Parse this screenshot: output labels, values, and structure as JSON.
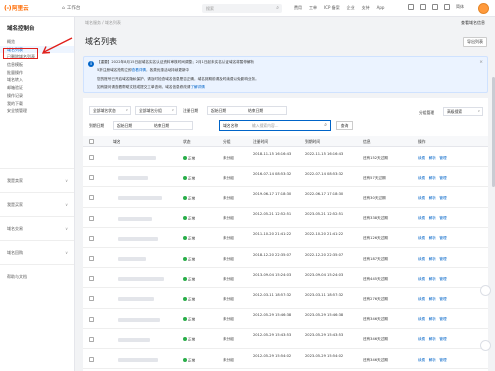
{
  "topbar": {
    "logo_mark": "(-)",
    "logo_text": "阿里云",
    "workbench": "工作台",
    "search_placeholder": "搜索",
    "nav": [
      "费用",
      "工单",
      "ICP 备案",
      "企业",
      "支持",
      "App"
    ],
    "lang": "简体"
  },
  "sidebar": {
    "title": "域名控制台",
    "items": [
      "概览",
      "域名列表",
      "已删除域名列表",
      "信息模板",
      "批量操作",
      "域名转入",
      "邮箱验证",
      "操作记录",
      "我的下载",
      "安全锁管理"
    ],
    "groups": [
      "我是卖家",
      "我是买家",
      "域名交易",
      "域名回购",
      "帮助与文档"
    ]
  },
  "main": {
    "breadcrumb": "域名服务 / 域名列表",
    "crumb_right": "查看域名信息",
    "title": "域名列表",
    "import_label": "导出列表",
    "notice": {
      "line1": "【重要】2022年8月15日起域名实名认证资料审核时间调整；2月1日起未实名认证域名将暂停解析",
      "line2_a": "5折注册域名抢购立即",
      "line2_link": "查看详情",
      "line2_b": "，各类优惠活动持续更新中",
      "line3": "您的账号已开启域名隐私保护，请及时检查域名信息是否正确，域名到期前请及时续费以免影响业务。",
      "line4_a": "如有疑问请查看帮助文档或提交工单咨询，域名信息修改请",
      "line4_link": "了解详情"
    },
    "filters": {
      "all_status": "全部域名状态",
      "all_group": "全部域名分组",
      "reg_date_label": "注册日期",
      "start": "起始日期",
      "end": "结束日期",
      "exp_date_label": "到期日期",
      "group_mgmt": "分组管理",
      "more_label": "高级搜索",
      "search_select": "域名名称",
      "search_placeholder": "输入搜索内容...",
      "query": "查询"
    },
    "columns": [
      "域名",
      "状态",
      "分组",
      "注册时间",
      "到期时间",
      "信息",
      "操作"
    ],
    "actions": [
      "续费",
      "解析",
      "管理"
    ],
    "rows": [
      {
        "status": "正常",
        "group": "未分组",
        "reg": "2018-11-15 16:16:43",
        "exp": "2022-11-15 16:16:43",
        "info": "还有152天过期"
      },
      {
        "status": "正常",
        "group": "未分组",
        "reg": "2016-07-14 08:53:32",
        "exp": "2022-07-14 08:53:32",
        "info": "还有57天过期"
      },
      {
        "status": "正常",
        "group": "未分组",
        "reg": "2019-06-17 17:18:30",
        "exp": "2022-06-17 17:18:30",
        "info": "还有30天过期"
      },
      {
        "status": "正常",
        "group": "未分组",
        "reg": "2012-05-21 12:52:51",
        "exp": "2023-05-21 12:52:51",
        "info": "还有338天过期"
      },
      {
        "status": "正常",
        "group": "未分组",
        "reg": "2011-10-20 21:41:22",
        "exp": "2022-10-20 21:41:22",
        "info": "还有126天过期"
      },
      {
        "status": "正常",
        "group": "未分组",
        "reg": "2018-12-20 22:35:07",
        "exp": "2022-12-20 22:35:07",
        "info": "还有187天过期"
      },
      {
        "status": "正常",
        "group": "未分组",
        "reg": "2013-09-04 15:24:03",
        "exp": "2023-09-04 15:24:03",
        "info": "还有445天过期"
      },
      {
        "status": "正常",
        "group": "未分组",
        "reg": "2012-03-11 18:57:32",
        "exp": "2023-03-11 18:57:32",
        "info": "还有276天过期"
      },
      {
        "status": "正常",
        "group": "未分组",
        "reg": "2012-05-29 15:46:38",
        "exp": "2023-05-29 15:46:38",
        "info": "还有346天过期"
      },
      {
        "status": "正常",
        "group": "未分组",
        "reg": "2012-05-29 15:43:53",
        "exp": "2023-05-29 15:43:53",
        "info": "还有346天过期"
      },
      {
        "status": "正常",
        "group": "未分组",
        "reg": "2012-05-29 15:54:02",
        "exp": "2023-05-29 15:54:02",
        "info": "还有346天过期"
      }
    ],
    "colors": {
      "accent": "#0064c8",
      "brand": "#ff6a00",
      "ok": "#2aae4a",
      "highlight": "#e0201b"
    }
  }
}
